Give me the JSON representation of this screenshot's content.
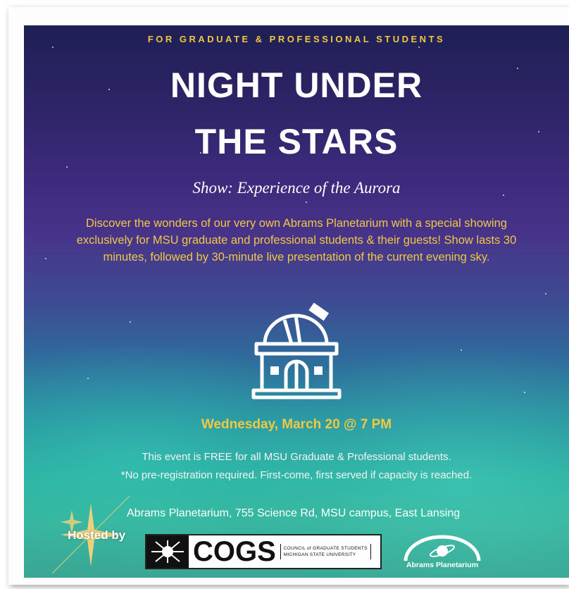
{
  "poster": {
    "tagline": "FOR GRADUATE & PROFESSIONAL STUDENTS",
    "title_line1": "NIGHT UNDER",
    "title_line2": "THE STARS",
    "show": "Show: Experience of the Aurora",
    "description": "Discover the wonders of our very own Abrams Planetarium with a special showing exclusively for MSU graduate and professional students & their guests! Show lasts 30 minutes, followed by 30-minute live presentation of the current evening sky.",
    "date": "Wednesday, March 20 @ 7 PM",
    "free_line1": "This event is FREE for all MSU Graduate & Professional students.",
    "free_line2": "*No pre-registration required. First-come, first served if capacity is reached.",
    "location": "Abrams Planetarium, 755 Science Rd, MSU campus, East Lansing",
    "hosted_by": "Hosted by"
  },
  "logos": {
    "cogs_word": "COGS",
    "cogs_sub1": "COUNCIL of GRADUATE STUDENTS",
    "cogs_sub2": "MICHIGAN STATE UNIVERSITY",
    "abrams_name": "Abrams Planetarium"
  },
  "colors": {
    "accent_gold": "#f2c744",
    "sky_top": "#1e1f55",
    "aurora": "#2aae9e"
  },
  "icons": [
    "observatory-icon",
    "sparkle-icon",
    "cogs-emblem-icon",
    "abrams-planetarium-logo"
  ]
}
